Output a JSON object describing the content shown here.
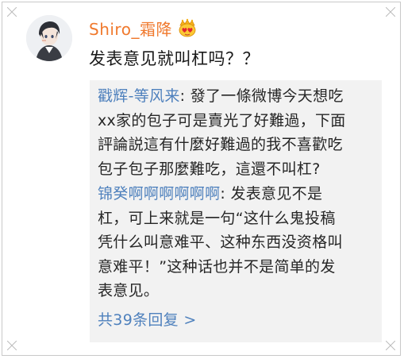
{
  "comment": {
    "username": "Shiro_霜降",
    "text": "发表意见就叫杠吗？？",
    "vip_icon": "crown-heart-badge-icon",
    "avatar_icon": "anime-character-avatar"
  },
  "replies": [
    {
      "author": "戳辉-等风来",
      "separator": ": ",
      "lines": [
        "發了一條微博今天想吃",
        "xx家的包子可是賣光了好難過，下面",
        "評論説這有什麼好難過的我不喜歡吃",
        "包子包子那麼難吃，這還不叫杠?"
      ]
    },
    {
      "author": "锦癸啊啊啊啊啊啊",
      "separator": ": ",
      "lines": [
        "发表意见不是",
        "杠，可上来就是一句“这什么鬼投稿",
        "凭什么叫意难平、这种东西没资格叫",
        "意难平！”这种话也并不是简单的发",
        "表意见。"
      ]
    }
  ],
  "more_replies": "共39条回复 >",
  "colors": {
    "username": "#f0792d",
    "link": "#4f81bd",
    "reply_bg": "#f2f2f2",
    "text": "#1a1a1a"
  }
}
